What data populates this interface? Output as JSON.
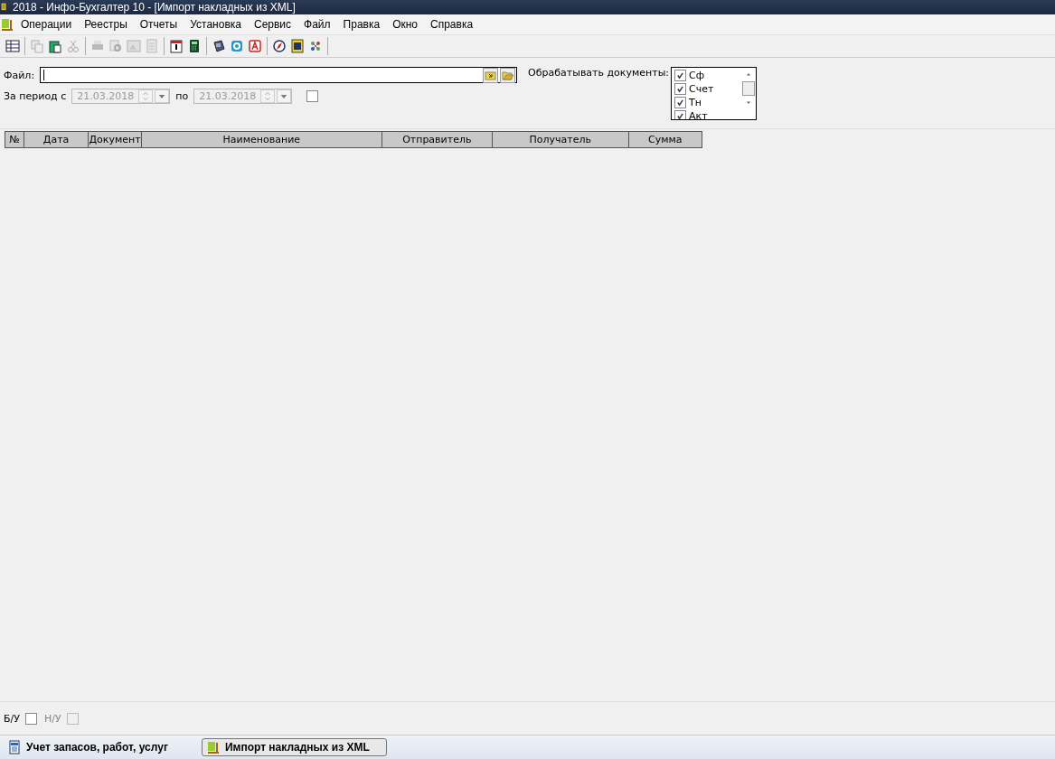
{
  "window": {
    "title": "2018 - Инфо-Бухгалтер 10 - [Импорт накладных из XML]"
  },
  "menu": [
    "Операции",
    "Реестры",
    "Отчеты",
    "Установка",
    "Сервис",
    "Файл",
    "Правка",
    "Окно",
    "Справка"
  ],
  "toolbar_groups": [
    [
      {
        "disabled": false
      }
    ],
    [
      {
        "disabled": true
      },
      {
        "disabled": false
      },
      {
        "disabled": true
      }
    ],
    [
      {
        "disabled": true
      },
      {
        "disabled": true
      },
      {
        "disabled": true
      },
      {
        "disabled": true
      }
    ],
    [
      {
        "disabled": false
      },
      {
        "disabled": false
      }
    ],
    [
      {
        "disabled": false
      },
      {
        "disabled": false
      },
      {
        "disabled": false
      }
    ],
    [
      {
        "disabled": false
      },
      {
        "disabled": false
      },
      {
        "disabled": false
      }
    ]
  ],
  "file": {
    "label": "Файл:"
  },
  "period": {
    "label_from": "За период с",
    "from": "21.03.2018",
    "label_to": "по",
    "to": "21.03.2018",
    "disabled": true,
    "checked": false
  },
  "documents": {
    "label": "Обрабатывать документы:",
    "items": [
      {
        "label": "Сф",
        "checked": true
      },
      {
        "label": "Счет",
        "checked": true
      },
      {
        "label": "Тн",
        "checked": true
      },
      {
        "label": "Акт",
        "checked": true
      }
    ]
  },
  "table": {
    "columns": [
      "№",
      "Дата",
      "Документ",
      "Наименование",
      "Отправитель",
      "Получатель",
      "Сумма"
    ]
  },
  "flags": [
    {
      "label": "Б/У",
      "checked": false,
      "disabled": false
    },
    {
      "label": "Н/У",
      "checked": false,
      "disabled": true
    }
  ],
  "taskbar": [
    {
      "label": "Учет запасов, работ, услуг",
      "selected": false
    },
    {
      "label": "Импорт накладных из XML",
      "selected": true
    }
  ]
}
